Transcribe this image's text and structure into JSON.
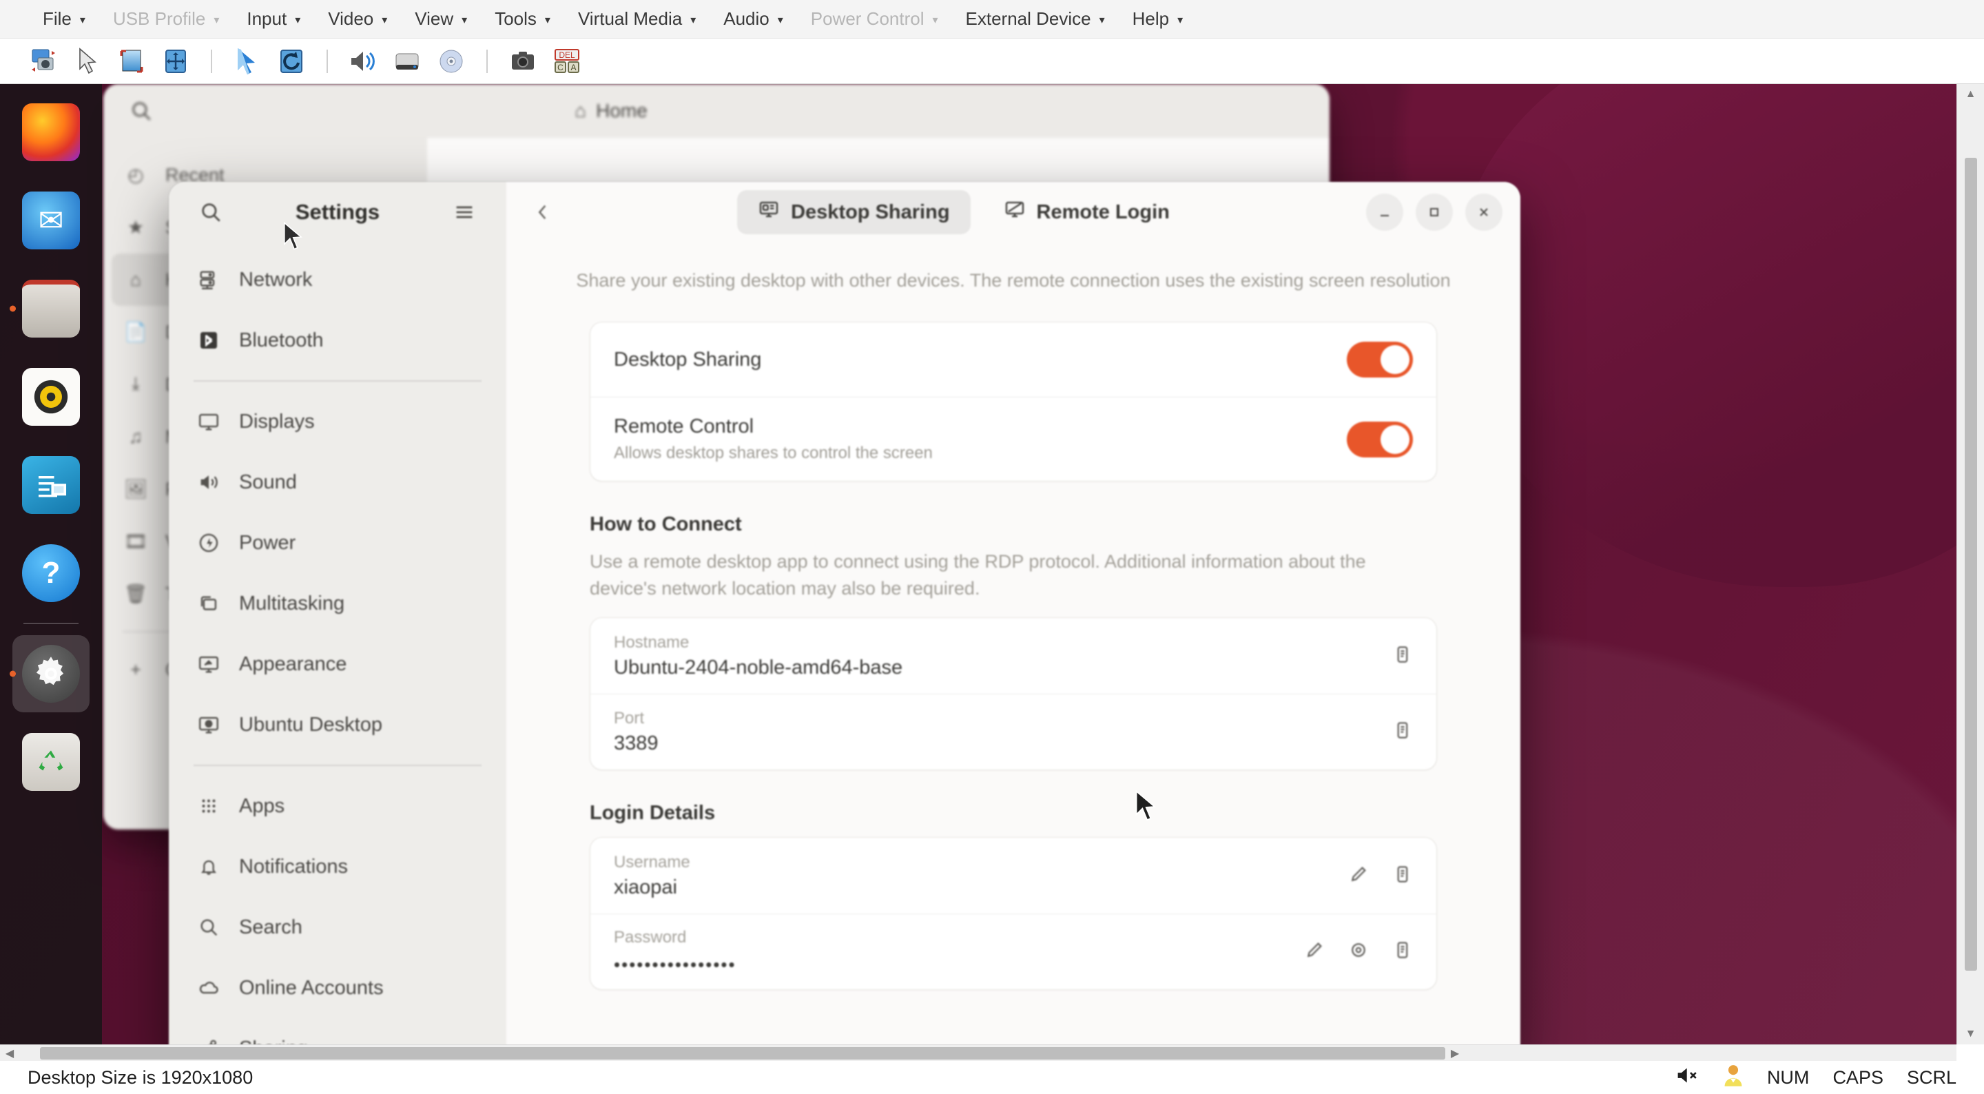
{
  "kvm": {
    "menus": [
      {
        "label": "File",
        "disabled": false
      },
      {
        "label": "USB Profile",
        "disabled": true
      },
      {
        "label": "Input",
        "disabled": false
      },
      {
        "label": "Video",
        "disabled": false
      },
      {
        "label": "View",
        "disabled": false
      },
      {
        "label": "Tools",
        "disabled": false
      },
      {
        "label": "Virtual Media",
        "disabled": false
      },
      {
        "label": "Audio",
        "disabled": false
      },
      {
        "label": "Power Control",
        "disabled": true
      },
      {
        "label": "External Device",
        "disabled": false
      },
      {
        "label": "Help",
        "disabled": false
      }
    ],
    "caret": "▾",
    "toolbar": [
      {
        "name": "video-settings-icon",
        "glyph": "⚙"
      },
      {
        "name": "cursor-arrow-icon",
        "glyph": "➤"
      },
      {
        "name": "resize-screen-icon",
        "glyph": "⤡"
      },
      {
        "name": "fit-to-screen-icon",
        "glyph": "✥"
      },
      {
        "name": "sep1",
        "glyph": "|"
      },
      {
        "name": "mouse-pointer-icon",
        "glyph": "➤"
      },
      {
        "name": "refresh-screen-icon",
        "glyph": "⟳"
      },
      {
        "name": "sep2",
        "glyph": "|"
      },
      {
        "name": "audio-icon",
        "glyph": "🔊"
      },
      {
        "name": "virtual-drive-icon",
        "glyph": "▭"
      },
      {
        "name": "virtual-disc-icon",
        "glyph": "◎"
      },
      {
        "name": "sep3",
        "glyph": "|"
      },
      {
        "name": "screenshot-camera-icon",
        "glyph": "📷"
      },
      {
        "name": "ctrl-alt-del-icon",
        "glyph": "DEL"
      }
    ]
  },
  "statusbar": {
    "desktop_size": "Desktop Size is 1920x1080",
    "mute_icon": "mute-speaker-icon",
    "user_icon": "user-avatar-icon",
    "num": "NUM",
    "caps": "CAPS",
    "scrl": "SCRL"
  },
  "dock": {
    "items": [
      {
        "name": "dock-item-firefox",
        "label": "Firefox",
        "glyph": "🦊",
        "bg": "linear-gradient(145deg,#ff9500,#e8452a 45%,#8a2be2)",
        "running": false,
        "active": false
      },
      {
        "name": "dock-item-thunderbird",
        "label": "Thunderbird",
        "glyph": "✉",
        "bg": "linear-gradient(145deg,#2aa9f0,#1565c0)",
        "running": false,
        "active": false
      },
      {
        "name": "dock-item-files",
        "label": "Files",
        "glyph": "🗀",
        "bg": "linear-gradient(180deg,#d8d4cf,#bab5ae)",
        "running": true,
        "active": false
      },
      {
        "name": "dock-item-rhythmbox",
        "label": "Rhythmbox",
        "glyph": "◉",
        "bg": "linear-gradient(145deg,#fdfdfd,#e8e6e1)",
        "running": false,
        "active": false
      },
      {
        "name": "dock-item-libreoffice-writer",
        "label": "LibreOffice Writer",
        "glyph": "☰",
        "bg": "linear-gradient(145deg,#2ab0e0,#1b7fb5)",
        "running": false,
        "active": false
      },
      {
        "name": "dock-item-help",
        "label": "Help",
        "glyph": "?",
        "bg": "radial-gradient(circle at 38% 34%,#4ab8f5,#1478d0)",
        "running": false,
        "active": false
      },
      {
        "name": "dock-separator",
        "label": "",
        "glyph": "",
        "bg": "",
        "running": false,
        "active": false
      },
      {
        "name": "dock-item-settings",
        "label": "Settings",
        "glyph": "⚙",
        "bg": "radial-gradient(circle at 40% 36%,#8b8b8b,#4a4a4a)",
        "running": true,
        "active": true
      },
      {
        "name": "dock-item-trash",
        "label": "Trash",
        "glyph": "♻",
        "bg": "linear-gradient(180deg,#e9e7e3,#cfccc6)",
        "running": false,
        "active": false
      }
    ]
  },
  "files_window": {
    "breadcrumb": "Home",
    "search_icon": "search-icon",
    "sidebar": [
      {
        "icon": "recent-icon",
        "glyph": "◴",
        "label": "Recent"
      },
      {
        "icon": "starred-icon",
        "glyph": "★",
        "label": "Starred"
      },
      {
        "icon": "home-icon",
        "glyph": "⌂",
        "label": "Home",
        "selected": true
      },
      {
        "icon": "documents-icon",
        "glyph": "📄",
        "label": "Documents"
      },
      {
        "icon": "downloads-icon",
        "glyph": "⤓",
        "label": "Downloads"
      },
      {
        "icon": "music-icon",
        "glyph": "♫",
        "label": "Music"
      },
      {
        "icon": "pictures-icon",
        "glyph": "🖼",
        "label": "Pictures"
      },
      {
        "icon": "videos-icon",
        "glyph": "🎞",
        "label": "Videos"
      },
      {
        "icon": "trash-icon",
        "glyph": "🗑",
        "label": "Trash"
      },
      {
        "icon": "other-locations-icon",
        "glyph": "+",
        "label": "Other Locations"
      }
    ]
  },
  "settings": {
    "sidebar": {
      "title": "Settings",
      "search_icon": "search-icon",
      "menu_icon": "hamburger-menu-icon",
      "items": [
        {
          "label": "Network",
          "icon": "network-icon",
          "glyph": "⌸"
        },
        {
          "label": "Bluetooth",
          "icon": "bluetooth-icon",
          "glyph": "ᛦ"
        },
        {
          "divider": true
        },
        {
          "label": "Displays",
          "icon": "display-icon",
          "glyph": "▭"
        },
        {
          "label": "Sound",
          "icon": "sound-icon",
          "glyph": "🔊"
        },
        {
          "label": "Power",
          "icon": "power-icon",
          "glyph": "⚡"
        },
        {
          "label": "Multitasking",
          "icon": "multitasking-icon",
          "glyph": "❐"
        },
        {
          "label": "Appearance",
          "icon": "appearance-icon",
          "glyph": "▣"
        },
        {
          "label": "Ubuntu Desktop",
          "icon": "ubuntu-desktop-icon",
          "glyph": "▤"
        },
        {
          "divider": true
        },
        {
          "label": "Apps",
          "icon": "apps-grid-icon",
          "glyph": "∷"
        },
        {
          "label": "Notifications",
          "icon": "bell-icon",
          "glyph": "🔔"
        },
        {
          "label": "Search",
          "icon": "search-icon",
          "glyph": "⌕"
        },
        {
          "label": "Online Accounts",
          "icon": "cloud-icon",
          "glyph": "☁"
        },
        {
          "label": "Sharing",
          "icon": "sharing-icon",
          "glyph": "⁂"
        }
      ]
    },
    "header": {
      "back_icon": "back-chevron-icon",
      "tabs": [
        {
          "label": "Desktop Sharing",
          "icon": "desktop-sharing-icon",
          "glyph": "▦",
          "active": true
        },
        {
          "label": "Remote Login",
          "icon": "remote-login-icon",
          "glyph": "▧",
          "active": false
        }
      ],
      "window_controls": [
        {
          "name": "minimize-button",
          "glyph": "—"
        },
        {
          "name": "maximize-button",
          "glyph": "□"
        },
        {
          "name": "close-button",
          "glyph": "✕"
        }
      ]
    },
    "desktop_sharing": {
      "hint": "Share your existing desktop with other devices. The remote connection uses the existing screen resolution",
      "toggles": [
        {
          "title": "Desktop Sharing",
          "subtitle": "",
          "state": "on"
        },
        {
          "title": "Remote Control",
          "subtitle": "Allows desktop shares to control the screen",
          "state": "on"
        }
      ],
      "how_to_connect": {
        "title": "How to Connect",
        "description": "Use a remote desktop app to connect using the RDP protocol. Additional information about the device's network location may also be required.",
        "fields": [
          {
            "label": "Hostname",
            "value": "Ubuntu-2404-noble-amd64-base",
            "actions": [
              "copy-icon"
            ]
          },
          {
            "label": "Port",
            "value": "3389",
            "actions": [
              "copy-icon"
            ]
          }
        ]
      },
      "login_details": {
        "title": "Login Details",
        "fields": [
          {
            "label": "Username",
            "value": "xiaopai",
            "actions": [
              "edit-icon",
              "copy-icon"
            ]
          },
          {
            "label": "Password",
            "value": "••••••••••••••••",
            "actions": [
              "edit-icon",
              "eye-icon",
              "copy-icon"
            ]
          }
        ]
      }
    }
  },
  "colors": {
    "accent_orange": "#e8562a",
    "wallpaper": "#4a0d28",
    "window_bg": "#fafaf9",
    "sidebar_bg": "#eeedea"
  }
}
